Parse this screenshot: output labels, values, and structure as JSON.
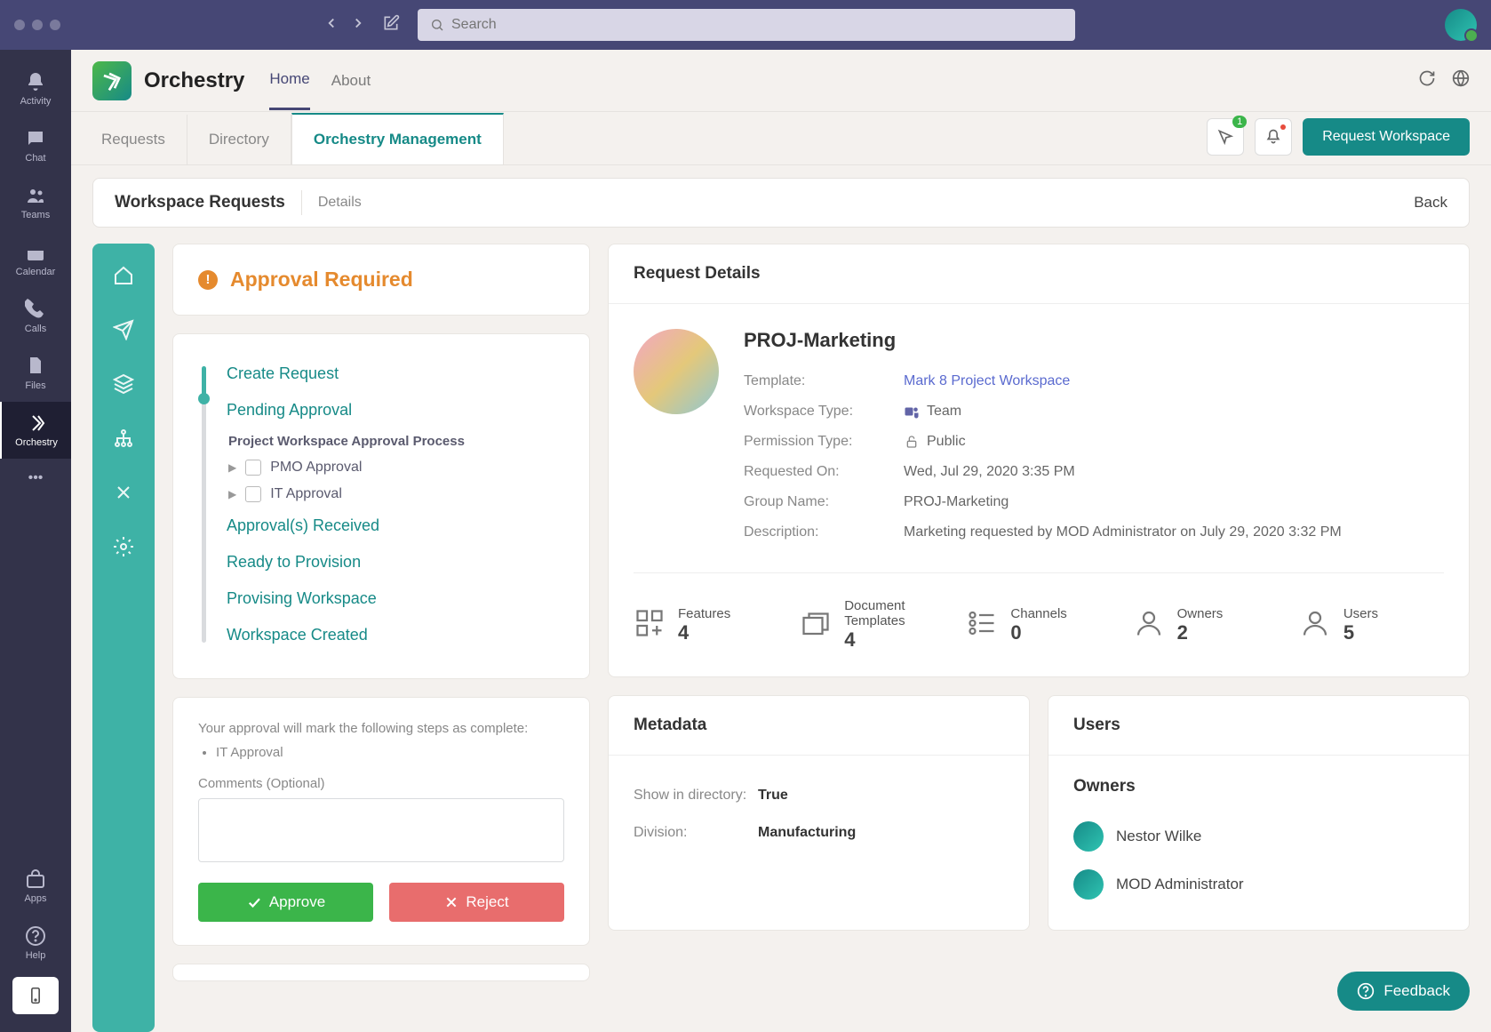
{
  "titlebar": {
    "search_placeholder": "Search"
  },
  "rail": {
    "activity": "Activity",
    "chat": "Chat",
    "teams": "Teams",
    "calendar": "Calendar",
    "calls": "Calls",
    "files": "Files",
    "orchestry": "Orchestry",
    "apps": "Apps",
    "help": "Help"
  },
  "app": {
    "name": "Orchestry",
    "tabs": {
      "home": "Home",
      "about": "About"
    }
  },
  "subtabs": {
    "requests": "Requests",
    "directory": "Directory",
    "management": "Orchestry Management"
  },
  "topbar": {
    "notif_count": "1",
    "request_workspace": "Request Workspace"
  },
  "breadcrumb": {
    "main": "Workspace Requests",
    "sub": "Details",
    "back": "Back"
  },
  "approval": {
    "title": "Approval Required"
  },
  "steps": {
    "create": "Create Request",
    "pending": "Pending Approval",
    "sub_title": "Project Workspace Approval Process",
    "pmo": "PMO Approval",
    "it": "IT Approval",
    "received": "Approval(s) Received",
    "ready": "Ready to Provision",
    "provisioning": "Provising Workspace",
    "created": "Workspace Created"
  },
  "approve": {
    "desc": "Your approval will mark the following steps as complete:",
    "item": "IT Approval",
    "comments_label": "Comments (Optional)",
    "approve_btn": "Approve",
    "reject_btn": "Reject"
  },
  "details": {
    "header": "Request Details",
    "name": "PROJ-Marketing",
    "labels": {
      "template": "Template:",
      "wtype": "Workspace Type:",
      "ptype": "Permission Type:",
      "requested": "Requested On:",
      "gname": "Group Name:",
      "desc": "Description:"
    },
    "values": {
      "template": "Mark 8 Project Workspace",
      "wtype": "Team",
      "ptype": "Public",
      "requested": "Wed, Jul 29, 2020 3:35 PM",
      "gname": "PROJ-Marketing",
      "desc": "Marketing requested by MOD Administrator on July 29, 2020 3:32 PM"
    }
  },
  "stats": {
    "features_label": "Features",
    "features_val": "4",
    "doc_label": "Document Templates",
    "doc_val": "4",
    "channels_label": "Channels",
    "channels_val": "0",
    "owners_label": "Owners",
    "owners_val": "2",
    "users_label": "Users",
    "users_val": "5"
  },
  "metadata": {
    "header": "Metadata",
    "show_label": "Show in directory:",
    "show_val": "True",
    "div_label": "Division:",
    "div_val": "Manufacturing"
  },
  "users_card": {
    "header": "Users",
    "owners_title": "Owners",
    "owner1": "Nestor Wilke",
    "owner2": "MOD Administrator"
  },
  "feedback": "Feedback"
}
